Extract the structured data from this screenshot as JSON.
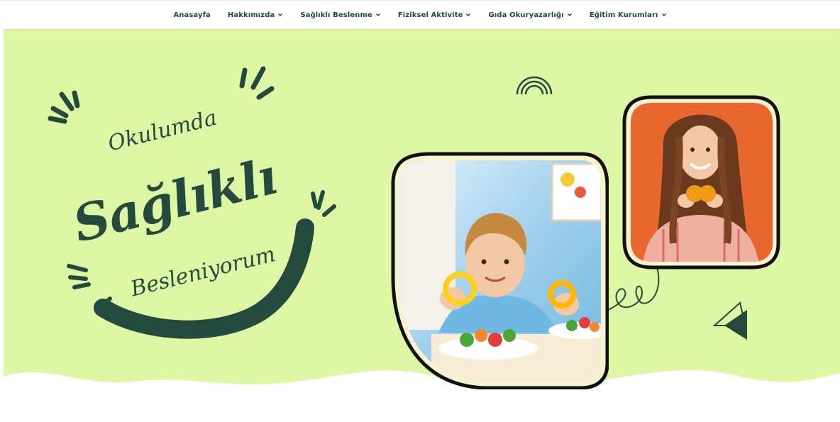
{
  "nav": {
    "items": [
      {
        "label": "Anasayfa",
        "has_dropdown": false
      },
      {
        "label": "Hakkımızda",
        "has_dropdown": true
      },
      {
        "label": "Sağlıklı Beslenme",
        "has_dropdown": true
      },
      {
        "label": "Fiziksel Aktivite",
        "has_dropdown": true
      },
      {
        "label": "Gıda Okuryazarlığı",
        "has_dropdown": true
      },
      {
        "label": "Eğitim Kurumları",
        "has_dropdown": true
      }
    ]
  },
  "hero": {
    "line1": "Okulumda",
    "line2": "Sağlıklı",
    "line3": "Besleniyorum",
    "images": [
      {
        "name": "boy-eating-vegetables-photo"
      },
      {
        "name": "girl-holding-orange-photo"
      }
    ]
  },
  "colors": {
    "hero_background": "#ddf7a5",
    "dark_green": "#234a3c",
    "nav_text": "#1f4a36",
    "frame_border": "#111111",
    "girl_photo_bg": "#e8672e"
  }
}
